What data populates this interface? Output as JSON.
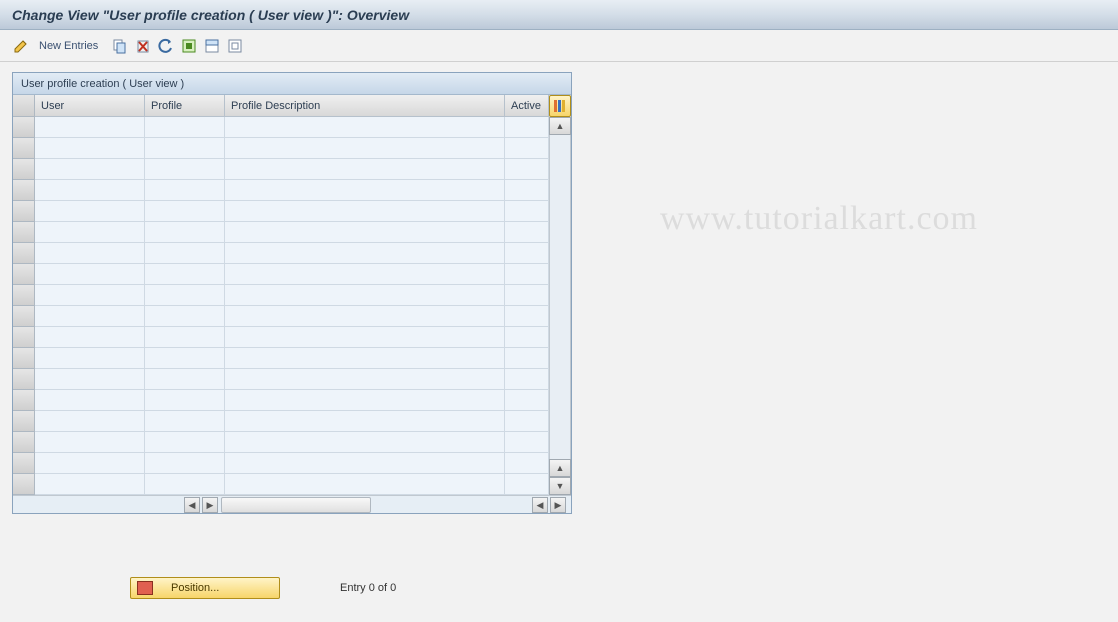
{
  "title": "Change View \"User profile creation ( User view )\": Overview",
  "toolbar": {
    "new_entries_label": "New Entries"
  },
  "panel": {
    "header": "User profile creation ( User view )",
    "columns": {
      "user": "User",
      "profile": "Profile",
      "description": "Profile Description",
      "active": "Active"
    },
    "rows": [
      {
        "user": "",
        "profile": "",
        "description": "",
        "active": ""
      },
      {
        "user": "",
        "profile": "",
        "description": "",
        "active": ""
      },
      {
        "user": "",
        "profile": "",
        "description": "",
        "active": ""
      },
      {
        "user": "",
        "profile": "",
        "description": "",
        "active": ""
      },
      {
        "user": "",
        "profile": "",
        "description": "",
        "active": ""
      },
      {
        "user": "",
        "profile": "",
        "description": "",
        "active": ""
      },
      {
        "user": "",
        "profile": "",
        "description": "",
        "active": ""
      },
      {
        "user": "",
        "profile": "",
        "description": "",
        "active": ""
      },
      {
        "user": "",
        "profile": "",
        "description": "",
        "active": ""
      },
      {
        "user": "",
        "profile": "",
        "description": "",
        "active": ""
      },
      {
        "user": "",
        "profile": "",
        "description": "",
        "active": ""
      },
      {
        "user": "",
        "profile": "",
        "description": "",
        "active": ""
      },
      {
        "user": "",
        "profile": "",
        "description": "",
        "active": ""
      },
      {
        "user": "",
        "profile": "",
        "description": "",
        "active": ""
      },
      {
        "user": "",
        "profile": "",
        "description": "",
        "active": ""
      },
      {
        "user": "",
        "profile": "",
        "description": "",
        "active": ""
      },
      {
        "user": "",
        "profile": "",
        "description": "",
        "active": ""
      },
      {
        "user": "",
        "profile": "",
        "description": "",
        "active": ""
      }
    ]
  },
  "footer": {
    "position_label": "Position...",
    "entry_text": "Entry 0 of 0"
  },
  "watermark": "www.tutorialkart.com"
}
